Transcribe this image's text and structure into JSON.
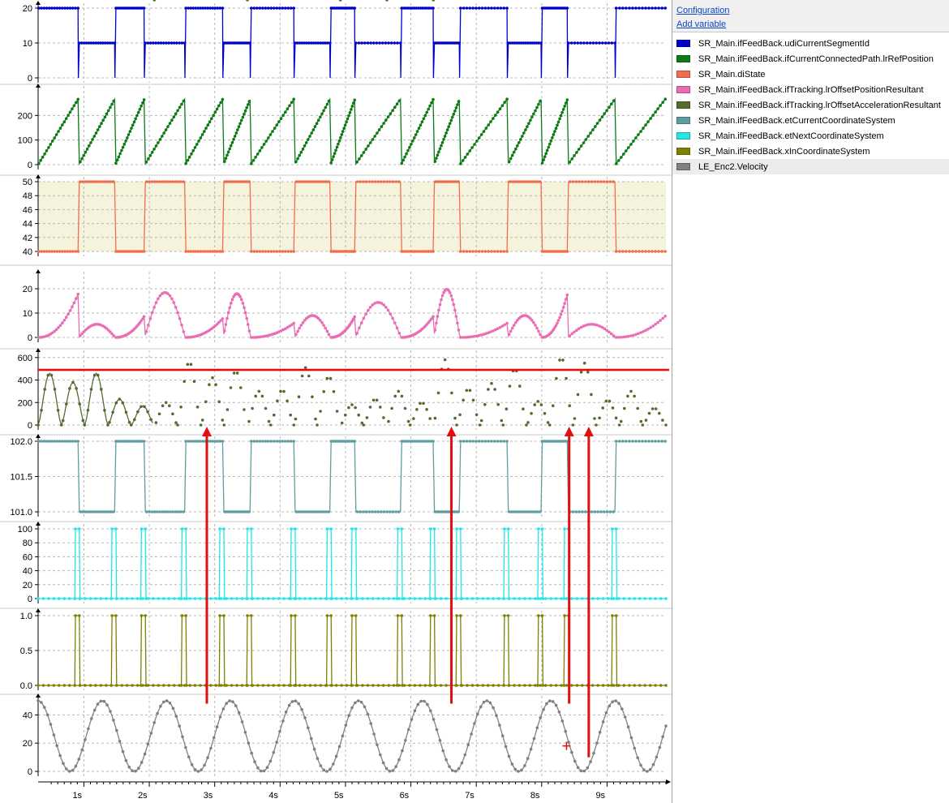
{
  "panel": {
    "configuration_label": "Configuration",
    "add_variable_label": "Add variable"
  },
  "legend": [
    {
      "name": "SR_Main.ifFeedBack.udiCurrentSegmentId",
      "color": "#0000cc",
      "selected": false
    },
    {
      "name": "SR_Main.ifFeedBack.ifCurrentConnectedPath.lrRefPosition",
      "color": "#0d7a14",
      "selected": false
    },
    {
      "name": "SR_Main.diState",
      "color": "#f06e4e",
      "selected": false
    },
    {
      "name": "SR_Main.ifFeedBack.ifTracking.lrOffsetPositionResultant",
      "color": "#ea6db4",
      "selected": false
    },
    {
      "name": "SR_Main.ifFeedBack.ifTracking.lrOffsetAccelerationResultant",
      "color": "#556b2f",
      "selected": false
    },
    {
      "name": "SR_Main.ifFeedBack.etCurrentCoordinateSystem",
      "color": "#5f9ea0",
      "selected": false
    },
    {
      "name": "SR_Main.ifFeedBack.etNextCoordinateSystem",
      "color": "#21e6e6",
      "selected": false
    },
    {
      "name": "SR_Main.ifFeedBack.xInCoordinateSystem",
      "color": "#808000",
      "selected": false
    },
    {
      "name": "LE_Enc2.Velocity",
      "color": "#808080",
      "selected": true
    }
  ],
  "chart_data": {
    "type": "line",
    "xlim": [
      0.3,
      9.9
    ],
    "x_unit": "s",
    "x_ticks": [
      1,
      2,
      3,
      4,
      5,
      6,
      7,
      8,
      9
    ],
    "x_tick_labels": [
      "1s",
      "2s",
      "3s",
      "4s",
      "5s",
      "6s",
      "7s",
      "8s",
      "9s"
    ],
    "cycle_times": [
      0.3,
      0.92,
      1.48,
      1.93,
      2.55,
      3.13,
      3.55,
      4.22,
      4.77,
      5.15,
      5.85,
      6.35,
      6.75,
      7.48,
      8.0,
      8.4,
      9.13,
      9.9
    ],
    "series": [
      {
        "name": "SR_Main.ifFeedBack.udiCurrentSegmentId",
        "color": "#0000cc",
        "ylim": [
          0,
          20
        ],
        "yticks": [
          0,
          10,
          20
        ],
        "levels": [
          10,
          20
        ],
        "start_level": 20
      },
      {
        "name": "SR_Main.ifFeedBack.ifCurrentConnectedPath.lrRefPosition",
        "color": "#0d7a14",
        "ylim": [
          0,
          300
        ],
        "yticks": [
          0,
          100,
          200
        ],
        "ramp_max": 270
      },
      {
        "name": "SR_Main.diState",
        "color": "#f06e4e",
        "ylim": [
          40,
          50
        ],
        "yticks": [
          40,
          42,
          44,
          46,
          48,
          50
        ],
        "levels": [
          40,
          50
        ],
        "start_level": 40,
        "background": "#f5f3dc"
      },
      {
        "name": "SR_Main.ifFeedBack.ifTracking.lrOffsetPositionResultant",
        "color": "#ea6db4",
        "ylim": [
          0,
          25
        ],
        "yticks": [
          0,
          10,
          20
        ],
        "peaks": [
          18.5,
          6,
          9,
          20.5,
          8,
          20,
          6,
          10,
          9,
          16,
          9,
          22,
          6,
          10
        ]
      },
      {
        "name": "SR_Main.ifFeedBack.ifTracking.lrOffsetAccelerationResultant",
        "color": "#556b2f",
        "ylim": [
          0,
          620
        ],
        "yticks": [
          0,
          200,
          400,
          600
        ],
        "threshold": 490,
        "threshold_color": "#ff0000"
      },
      {
        "name": "SR_Main.ifFeedBack.etCurrentCoordinateSystem",
        "color": "#5f9ea0",
        "ylim": [
          101,
          102
        ],
        "yticks": [
          101.0,
          101.5,
          102.0
        ],
        "levels": [
          101,
          102
        ],
        "start_level": 102
      },
      {
        "name": "SR_Main.ifFeedBack.etNextCoordinateSystem",
        "color": "#21e6e6",
        "ylim": [
          0,
          100
        ],
        "yticks": [
          0,
          20,
          40,
          60,
          80,
          100
        ],
        "pulse_value": 100
      },
      {
        "name": "SR_Main.ifFeedBack.xInCoordinateSystem",
        "color": "#808000",
        "ylim": [
          0,
          1
        ],
        "yticks": [
          0,
          0.5,
          1.0
        ],
        "pulse_value": 1
      },
      {
        "name": "LE_Enc2.Velocity",
        "color": "#808080",
        "ylim": [
          0,
          50
        ],
        "yticks": [
          0,
          20,
          40
        ],
        "amplitude": 25,
        "offset": 25,
        "period_s": 0.98,
        "first_peak_s": 0.3
      }
    ],
    "annotations": {
      "color": "#e01010",
      "arrows": [
        {
          "x": 2.88,
          "from": 48,
          "to_panel": "lrOffsetAccelerationResultant"
        },
        {
          "x": 6.62,
          "from": 48,
          "to_panel": "lrOffsetAccelerationResultant"
        },
        {
          "x": 8.42,
          "from": 48,
          "to_panel": "lrOffsetAccelerationResultant"
        },
        {
          "x": 8.72,
          "from": 10,
          "to_panel": "lrOffsetAccelerationResultant"
        }
      ],
      "cursor_marker": {
        "x": 8.38,
        "y": 18
      }
    }
  }
}
